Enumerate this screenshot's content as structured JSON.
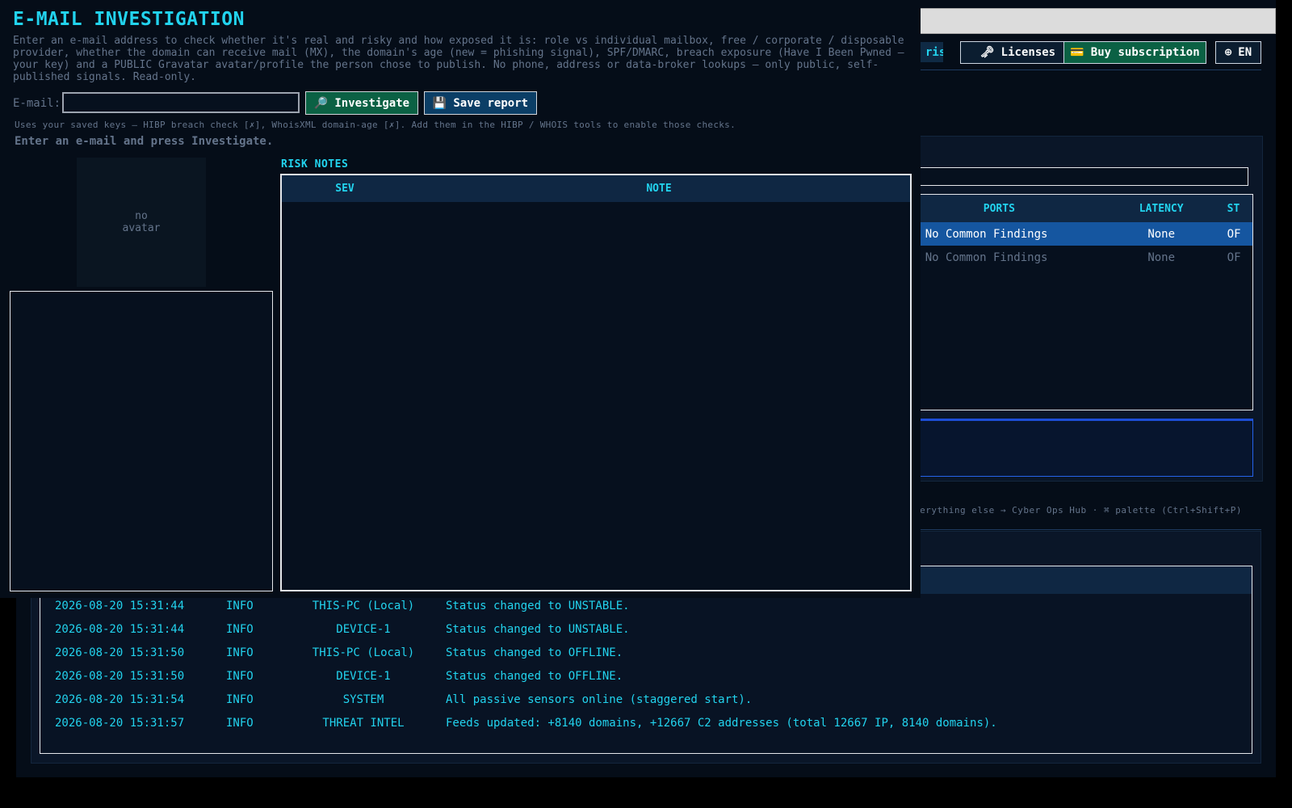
{
  "background": {
    "header_buttons": {
      "enterprise_fragment": "rise",
      "licenses": "Licenses",
      "buy_subscription": "Buy subscription",
      "language": "EN"
    },
    "devices_table": {
      "columns": [
        "PORTS",
        "LATENCY",
        "ST"
      ],
      "rows": [
        {
          "ports": "E / No Common Findings",
          "latency": "None",
          "status": "OF",
          "selected": true
        },
        {
          "ports": "E / No Common Findings",
          "latency": "None",
          "status": "OF",
          "selected": false
        }
      ]
    },
    "footer_hint": "verything else → Cyber Ops Hub  ·  ⌘ palette (Ctrl+Shift+P)",
    "event_log": [
      {
        "timestamp": "2026-08-20 15:31:44",
        "level": "INFO",
        "source": "THIS-PC (Local)",
        "message": "Status changed to UNSTABLE."
      },
      {
        "timestamp": "2026-08-20 15:31:44",
        "level": "INFO",
        "source": "DEVICE-1",
        "message": "Status changed to UNSTABLE."
      },
      {
        "timestamp": "2026-08-20 15:31:50",
        "level": "INFO",
        "source": "THIS-PC (Local)",
        "message": "Status changed to OFFLINE."
      },
      {
        "timestamp": "2026-08-20 15:31:50",
        "level": "INFO",
        "source": "DEVICE-1",
        "message": "Status changed to OFFLINE."
      },
      {
        "timestamp": "2026-08-20 15:31:54",
        "level": "INFO",
        "source": "SYSTEM",
        "message": "All passive sensors online (staggered start)."
      },
      {
        "timestamp": "2026-08-20 15:31:57",
        "level": "INFO",
        "source": "THREAT INTEL",
        "message": "Feeds updated: +8140 domains, +12667 C2 addresses (total 12667 IP, 8140 domains)."
      }
    ]
  },
  "email_investigation": {
    "title": "E-MAIL INVESTIGATION",
    "description": "Enter an e-mail address to check whether it's real and risky and how exposed it is: role vs individual mailbox, free / corporate / disposable provider, whether the domain can receive mail (MX), the domain's age (new = phishing signal), SPF/DMARC, breach exposure (Have I Been Pwned — your key) and a PUBLIC Gravatar avatar/profile the person chose to publish. No phone, address or data-broker lookups — only public, self-published signals. Read-only.",
    "email_label": "E-mail:",
    "email_value": "",
    "investigate_button": "Investigate",
    "save_button": "Save report",
    "keys_note": "Uses your saved keys — HIBP breach check [✗], WhoisXML domain-age [✗]. Add them in the HIBP / WHOIS tools to enable those checks.",
    "status": "Enter an e-mail and press Investigate.",
    "avatar_placeholder_line1": "no",
    "avatar_placeholder_line2": "avatar",
    "risk_notes": {
      "label": "RISK NOTES",
      "columns": {
        "sev": "SEV",
        "note": "NOTE"
      },
      "rows": []
    }
  },
  "icons": {
    "licenses": "key-icon",
    "buy_subscription": "card-icon",
    "language": "globe-icon",
    "investigate": "magnifier-icon",
    "save": "floppy-icon"
  },
  "colors": {
    "accent": "#22d3ee",
    "muted": "#64748b",
    "investigate_bg": "#0b6144",
    "save_bg": "#0b3e66",
    "selected_row": "#1556a0"
  }
}
